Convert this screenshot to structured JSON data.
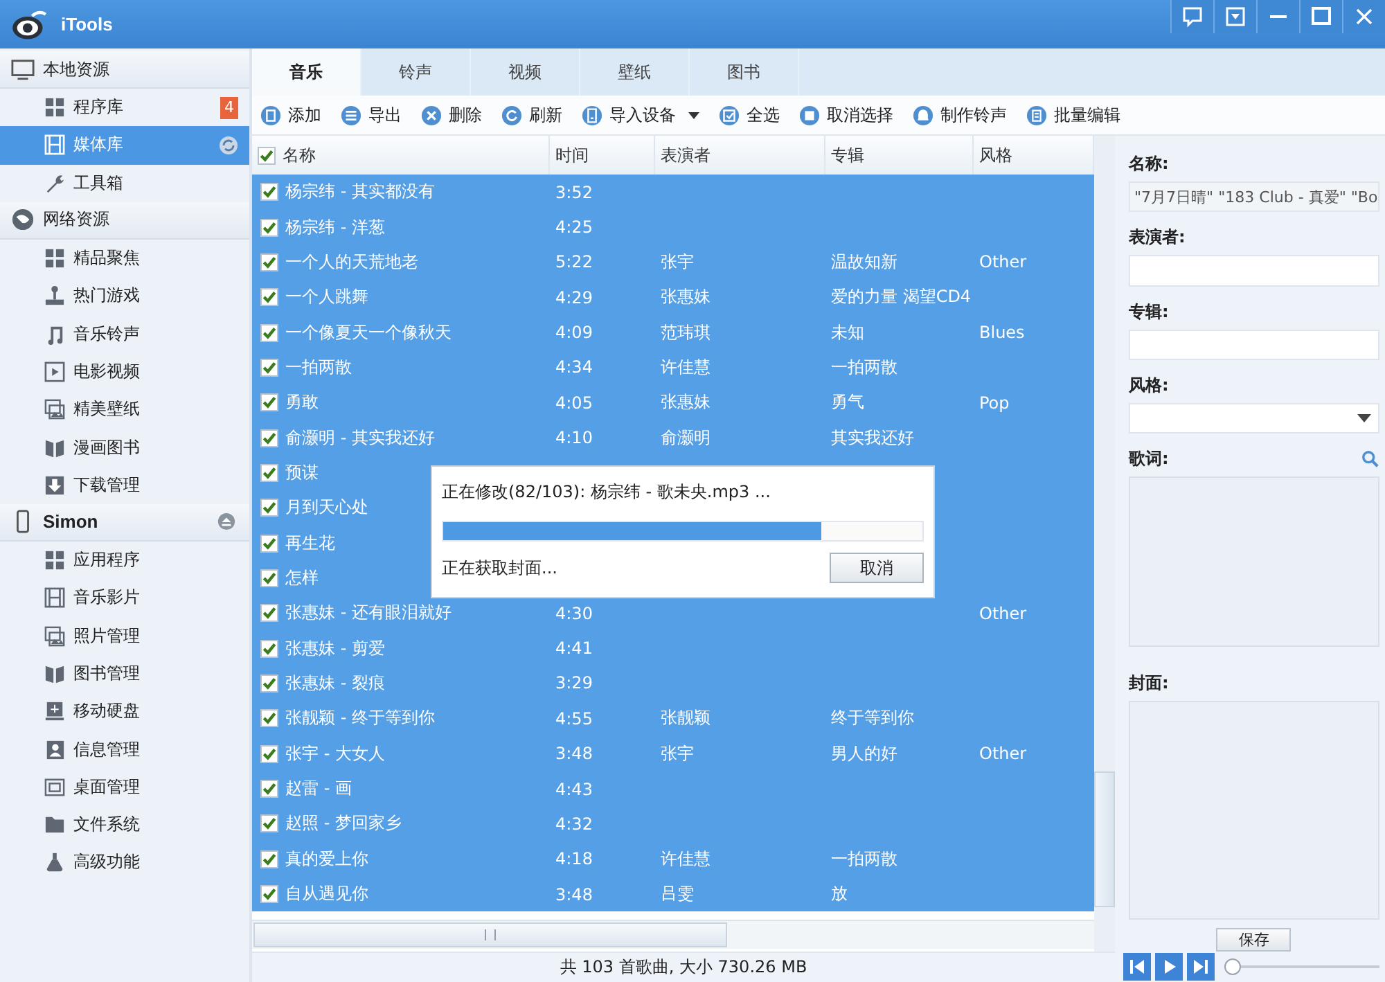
{
  "window": {
    "title": "iTools"
  },
  "sidebar": {
    "sections": [
      {
        "label": "本地资源",
        "kind": "local",
        "items": [
          {
            "label": "程序库",
            "badge": "4",
            "selected": false
          },
          {
            "label": "媒体库",
            "selected": true,
            "syncing": true
          },
          {
            "label": "工具箱",
            "selected": false
          }
        ]
      },
      {
        "label": "网络资源",
        "kind": "web",
        "items": [
          {
            "label": "精品聚焦",
            "selected": false
          },
          {
            "label": "热门游戏",
            "selected": false
          },
          {
            "label": "音乐铃声",
            "selected": false
          },
          {
            "label": "电影视频",
            "selected": false
          },
          {
            "label": "精美壁纸",
            "selected": false
          },
          {
            "label": "漫画图书",
            "selected": false
          },
          {
            "label": "下载管理",
            "selected": false
          }
        ]
      },
      {
        "label": "Simon",
        "kind": "device",
        "items": [
          {
            "label": "应用程序",
            "selected": false
          },
          {
            "label": "音乐影片",
            "selected": false
          },
          {
            "label": "照片管理",
            "selected": false
          },
          {
            "label": "图书管理",
            "selected": false
          },
          {
            "label": "移动硬盘",
            "selected": false
          },
          {
            "label": "信息管理",
            "selected": false
          },
          {
            "label": "桌面管理",
            "selected": false
          },
          {
            "label": "文件系统",
            "selected": false
          },
          {
            "label": "高级功能",
            "selected": false
          }
        ]
      }
    ]
  },
  "tabs": [
    {
      "label": "音乐",
      "selected": true
    },
    {
      "label": "铃声",
      "selected": false
    },
    {
      "label": "视频",
      "selected": false
    },
    {
      "label": "壁纸",
      "selected": false
    },
    {
      "label": "图书",
      "selected": false
    }
  ],
  "toolbar": [
    {
      "label": "添加",
      "kind": "add"
    },
    {
      "label": "导出",
      "kind": "export"
    },
    {
      "label": "删除",
      "kind": "delete"
    },
    {
      "label": "刷新",
      "kind": "refresh"
    },
    {
      "label": "导入设备",
      "kind": "device",
      "dropdown": true
    },
    {
      "label": "全选",
      "kind": "selectall"
    },
    {
      "label": "取消选择",
      "kind": "deselect"
    },
    {
      "label": "制作铃声",
      "kind": "ringtone"
    },
    {
      "label": "批量编辑",
      "kind": "batch"
    }
  ],
  "table": {
    "all_checked": true,
    "columns": [
      "名称",
      "时间",
      "表演者",
      "专辑",
      "风格"
    ],
    "rows": [
      {
        "checked": true,
        "name": "杨宗纬 - 其实都没有",
        "time": "3:52"
      },
      {
        "checked": true,
        "name": "杨宗纬 - 洋葱",
        "time": "4:25"
      },
      {
        "checked": true,
        "name": "一个人的天荒地老",
        "time": "5:22",
        "artist": "张宇",
        "album": "温故知新",
        "genre": "Other"
      },
      {
        "checked": true,
        "name": "一个人跳舞",
        "time": "4:29",
        "artist": "张惠妹",
        "album": "爱的力量 渴望CD4"
      },
      {
        "checked": true,
        "name": "一个像夏天一个像秋天",
        "time": "4:09",
        "artist": "范玮琪",
        "album": "未知",
        "genre": "Blues"
      },
      {
        "checked": true,
        "name": "一拍两散",
        "time": "4:34",
        "artist": "许佳慧",
        "album": "一拍两散"
      },
      {
        "checked": true,
        "name": "勇敢",
        "time": "4:05",
        "artist": "张惠妹",
        "album": "勇气",
        "genre": "Pop"
      },
      {
        "checked": true,
        "name": "俞灏明 - 其实我还好",
        "time": "4:10",
        "artist": "俞灏明",
        "album": "其实我还好"
      },
      {
        "checked": true,
        "name": "预谋"
      },
      {
        "checked": true,
        "name": "月到天心处"
      },
      {
        "checked": true,
        "name": "再生花"
      },
      {
        "checked": true,
        "name": "怎样"
      },
      {
        "checked": true,
        "name": "张惠妹 - 还有眼泪就好",
        "time": "4:30",
        "genre": "Other"
      },
      {
        "checked": true,
        "name": "张惠妹 - 剪爱",
        "time": "4:41"
      },
      {
        "checked": true,
        "name": "张惠妹 - 裂痕",
        "time": "3:29"
      },
      {
        "checked": true,
        "name": "张靓颖 - 终于等到你",
        "time": "4:55",
        "artist": "张靓颖",
        "album": "终于等到你"
      },
      {
        "checked": true,
        "name": "张宇 - 大女人",
        "time": "3:48",
        "artist": "张宇",
        "album": "男人的好",
        "genre": "Other"
      },
      {
        "checked": true,
        "name": "赵雷 - 画",
        "time": "4:43"
      },
      {
        "checked": true,
        "name": "赵照 - 梦回家乡",
        "time": "4:32"
      },
      {
        "checked": true,
        "name": "真的爱上你",
        "time": "4:18",
        "artist": "许佳慧",
        "album": "一拍两散"
      },
      {
        "checked": true,
        "name": "自从遇见你",
        "time": "3:48",
        "artist": "吕雯",
        "album": "放"
      }
    ]
  },
  "dialog": {
    "message": "正在修改(82/103): 杨宗纬 - 歌未央.mp3 ...",
    "level": 0.79,
    "status": "正在获取封面...",
    "button": "取消"
  },
  "details": {
    "name_label": "名称:",
    "name_value": "\"7月7日晴\" \"183 Club - 真爱\" \"Bo",
    "artist_label": "表演者:",
    "album_label": "专辑:",
    "genre_label": "风格:",
    "lyrics_label": "歌词:",
    "cover_label": "封面:",
    "save": "保存"
  },
  "status_bar": "共 103 首歌曲, 大小 730.26 MB",
  "player": {
    "level": 0
  }
}
